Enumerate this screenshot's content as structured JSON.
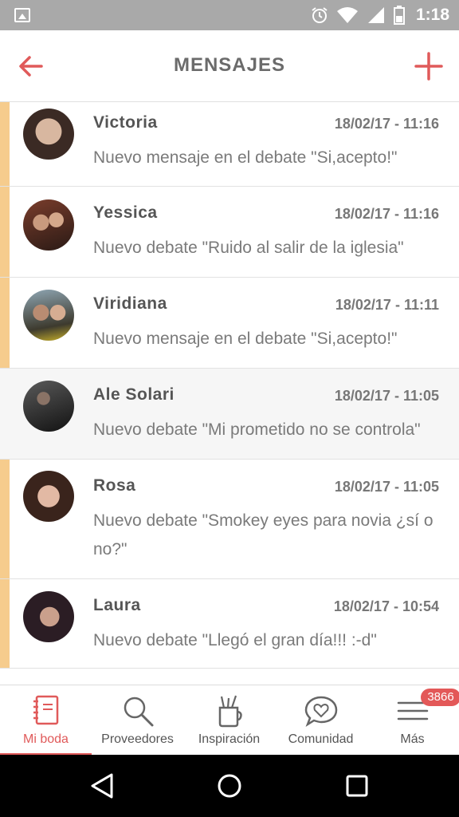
{
  "status_bar": {
    "time": "1:18"
  },
  "header": {
    "title": "MENSAJES",
    "accent_color": "#e05a5a"
  },
  "messages": [
    {
      "name": "Victoria",
      "date": "18/02/17 - 11:16",
      "text": "Nuevo mensaje en el debate \"Si,acepto!\"",
      "unread": true
    },
    {
      "name": "Yessica",
      "date": "18/02/17 - 11:16",
      "text": "Nuevo debate \"Ruido al salir de la iglesia\"",
      "unread": true
    },
    {
      "name": "Viridiana",
      "date": "18/02/17 - 11:11",
      "text": "Nuevo mensaje en el debate \"Si,acepto!\"",
      "unread": true
    },
    {
      "name": "Ale Solari",
      "date": "18/02/17 - 11:05",
      "text": "Nuevo debate \"Mi prometido no se controla\"",
      "unread": false
    },
    {
      "name": "Rosa",
      "date": "18/02/17 - 11:05",
      "text": "Nuevo debate \"Smokey eyes para novia ¿sí o no?\"",
      "unread": true
    },
    {
      "name": "Laura",
      "date": "18/02/17 - 10:54",
      "text": "Nuevo debate \"Llegó el gran día!!! :-d\"",
      "unread": true
    }
  ],
  "bottom_nav": {
    "items": [
      {
        "label": "Mi boda",
        "icon": "notebook-icon",
        "active": true
      },
      {
        "label": "Proveedores",
        "icon": "search-icon",
        "active": false
      },
      {
        "label": "Inspiración",
        "icon": "pencil-cup-icon",
        "active": false
      },
      {
        "label": "Comunidad",
        "icon": "heart-chat-icon",
        "active": false
      },
      {
        "label": "Más",
        "icon": "menu-icon",
        "active": false,
        "badge": "3866"
      }
    ]
  },
  "colors": {
    "unread_bar": "#f6cc8d",
    "badge": "#e35858",
    "status_bar": "#a9a9a9"
  }
}
